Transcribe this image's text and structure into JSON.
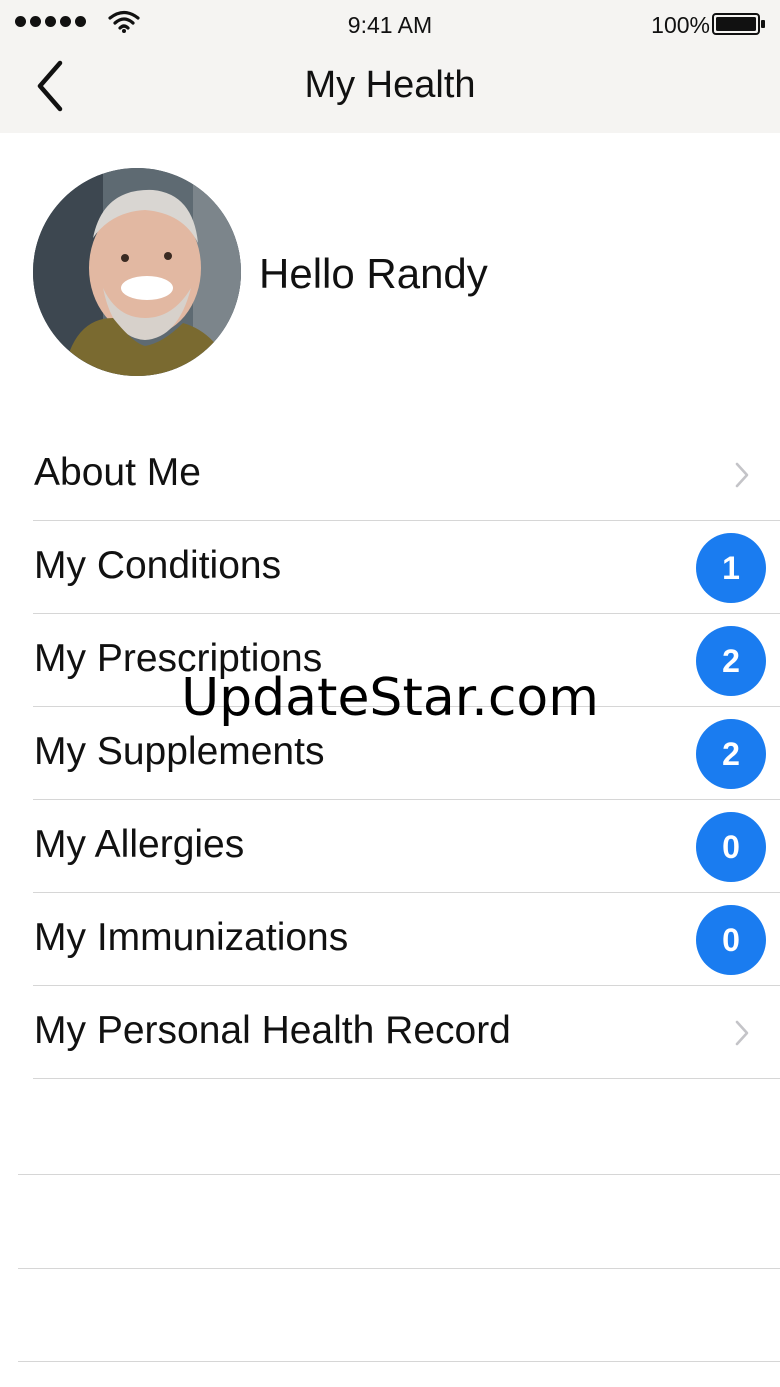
{
  "status_bar": {
    "time": "9:41 AM",
    "battery": "100%"
  },
  "nav": {
    "title": "My Health"
  },
  "profile": {
    "greeting": "Hello Randy"
  },
  "menu": [
    {
      "label": "About Me",
      "badge": null,
      "chevron": true
    },
    {
      "label": "My Conditions",
      "badge": "1",
      "chevron": false
    },
    {
      "label": "My Prescriptions",
      "badge": "2",
      "chevron": false
    },
    {
      "label": "My Supplements",
      "badge": "2",
      "chevron": false
    },
    {
      "label": "My Allergies",
      "badge": "0",
      "chevron": false
    },
    {
      "label": "My Immunizations",
      "badge": "0",
      "chevron": false
    },
    {
      "label": "My Personal Health Record",
      "badge": null,
      "chevron": true
    }
  ],
  "watermark": "UpdateStar.com",
  "colors": {
    "badge": "#1a7cf0",
    "topbar": "#f5f4f2",
    "separator": "#d6d6d6"
  }
}
